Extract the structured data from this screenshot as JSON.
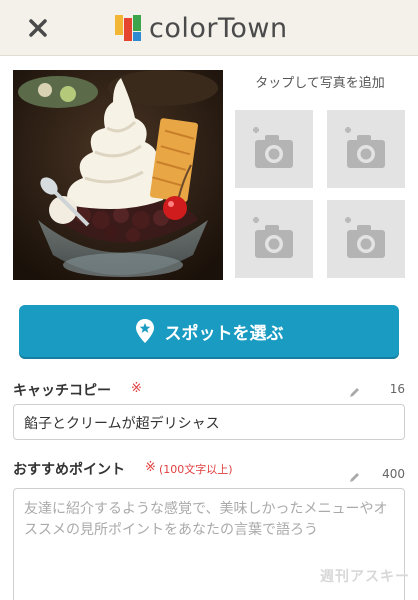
{
  "header": {
    "close_icon": "close-icon",
    "logo_text": "colorTown",
    "logo_colors": [
      "#f2b634",
      "#e5442f",
      "#3ca54b",
      "#2f8ad1"
    ]
  },
  "photos": {
    "add_text": "タップして写真を追加",
    "slot_icon": "camera-plus-icon",
    "slot_count": 4
  },
  "spot_button": {
    "label": "スポットを選ぶ",
    "icon": "map-pin-star-icon",
    "color": "#1a9bc1"
  },
  "catch_copy": {
    "label": "キャッチコピー",
    "required": "※",
    "count": "16",
    "value": "餡子とクリームが超デリシャス"
  },
  "recommend": {
    "label": "おすすめポイント",
    "required": "※",
    "note": "(100文字以上)",
    "count": "400",
    "placeholder": "友達に紹介するような感覚で、美味しかったメニューやオススメの見所ポイントをあなたの言葉で語ろう"
  },
  "watermark": "週刊アスキー",
  "accent_required": "#e04040"
}
